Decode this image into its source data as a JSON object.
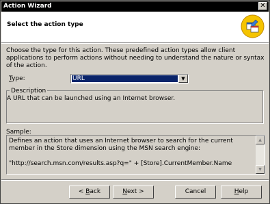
{
  "window": {
    "title": "Action Wizard",
    "close_glyph": "✕"
  },
  "header": {
    "title": "Select the action type",
    "icon": "wizard-icon"
  },
  "intro_text": "Choose the type for this action. These predefined action types allow client applications to perform actions without needing to understand the nature or syntax of the action.",
  "type_field": {
    "label": "Type:",
    "value": "URL"
  },
  "description": {
    "legend": "Description",
    "text": "A URL that can be launched using an Internet browser."
  },
  "sample": {
    "label": "Sample:",
    "text": "Defines an action that uses an Internet browser to search for the current member in the Store dimension using the MSN search engine:\n\n\"http://search.msn.com/results.asp?q=\" + [Store].CurrentMember.Name"
  },
  "buttons": {
    "back": "< Back",
    "next": "Next >",
    "cancel": "Cancel",
    "help": "Help"
  },
  "colors": {
    "title_bar": "#000000",
    "selection": "#0a246a",
    "face": "#d4d0c8"
  }
}
